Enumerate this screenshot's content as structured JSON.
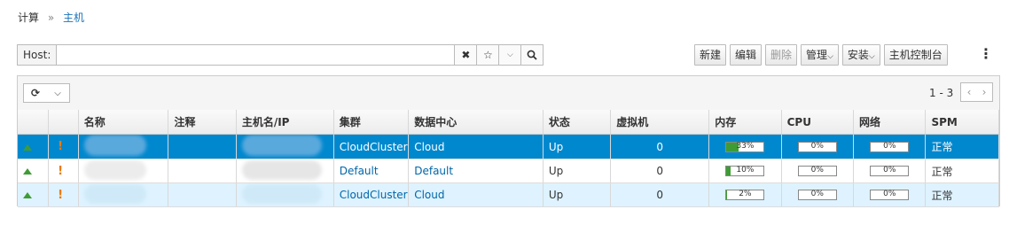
{
  "breadcrumb": {
    "root": "计算",
    "separator": "»",
    "current": "主机"
  },
  "search": {
    "label": "Host:",
    "value": ""
  },
  "actions": {
    "new": "新建",
    "edit": "编辑",
    "delete": "删除",
    "manage": "管理",
    "install": "安装",
    "console": "主机控制台"
  },
  "pager": {
    "range": "1 - 3"
  },
  "columns": [
    "名称",
    "注释",
    "主机名/IP",
    "集群",
    "数据中心",
    "状态",
    "虚拟机",
    "内存",
    "CPU",
    "网络",
    "SPM"
  ],
  "rows": [
    {
      "name": "",
      "comment": "",
      "host": "",
      "cluster": "CloudCluster",
      "datacenter": "Cloud",
      "status": "Up",
      "vms": "0",
      "memory": "33%",
      "memory_value": 33,
      "cpu": "0%",
      "cpu_value": 0,
      "network": "0%",
      "network_value": 0,
      "spm": "正常"
    },
    {
      "name": "",
      "comment": "",
      "host": "",
      "cluster": "Default",
      "datacenter": "Default",
      "status": "Up",
      "vms": "0",
      "memory": "10%",
      "memory_value": 10,
      "cpu": "0%",
      "cpu_value": 0,
      "network": "0%",
      "network_value": 0,
      "spm": "正常"
    },
    {
      "name": "",
      "comment": "",
      "host": "",
      "cluster": "CloudCluster",
      "datacenter": "Cloud",
      "status": "Up",
      "vms": "0",
      "memory": "2%",
      "memory_value": 2,
      "cpu": "0%",
      "cpu_value": 0,
      "network": "0%",
      "network_value": 0,
      "spm": "正常"
    }
  ],
  "colors": {
    "selected_row": "#0088ce",
    "alt_row": "#def3ff",
    "link": "#0066a8",
    "status_up": "#3f9c35",
    "warning": "#ec7a08"
  },
  "icons": {
    "clear": "close-icon",
    "bookmark": "star-icon",
    "search": "search-icon",
    "refresh": "refresh-icon",
    "status": "up-arrow-icon",
    "alert": "exclamation-icon"
  }
}
